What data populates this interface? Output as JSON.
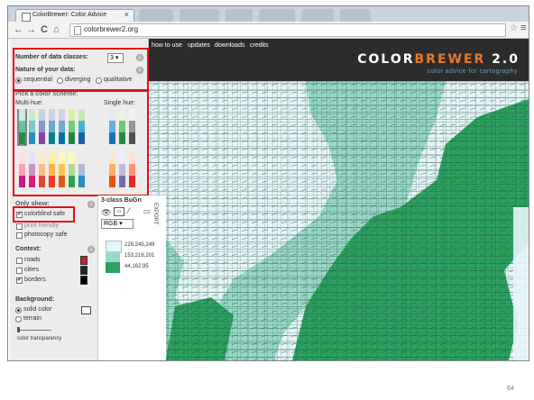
{
  "browser": {
    "tab_title": "ColorBrewer: Color Advice",
    "tab_close": "×",
    "back": "←",
    "forward": "→",
    "reload": "C",
    "home": "⌂",
    "url": "colorbrewer2.org",
    "star": "☆",
    "menu": "≡"
  },
  "nav": {
    "links": [
      "how to use",
      "updates",
      "downloads",
      "credits"
    ]
  },
  "brand": {
    "color_part": "COLOR",
    "brewer_part": "BREWER",
    "version": " 2.0",
    "tagline": "color advice for cartography"
  },
  "controls": {
    "num_classes_label": "Number of data classes:",
    "num_classes_value": "3",
    "nature_label": "Nature of your data:",
    "nature_options": [
      "sequential",
      "diverging",
      "qualitative"
    ],
    "nature_selected": "sequential",
    "scheme_label": "Pick a color scheme:",
    "multi_hue_label": "Multi-hue:",
    "single_hue_label": "Single hue:",
    "only_show_label": "Only show:",
    "colorblind_safe": "colorblind safe",
    "print_friendly": "print friendly",
    "photocopy_safe": "photocopy safe",
    "context_label": "Context:",
    "roads": "roads",
    "cities": "cities",
    "borders": "borders",
    "background_label": "Background:",
    "solid_color": "solid color",
    "terrain": "terrain",
    "color_transparency": "color transparency"
  },
  "legend": {
    "title": "3-class BuGn",
    "format": "RGB",
    "export": "EXPORT",
    "entries": [
      {
        "value": "229,245,249",
        "color": "#e5f5f9"
      },
      {
        "value": "153,216,201",
        "color": "#99d8c9"
      },
      {
        "value": "44,162,95",
        "color": "#2ca25f"
      }
    ]
  },
  "colors": {
    "accent": "#e37a2a",
    "highlight": "#e0121c"
  },
  "slide_number": "64"
}
